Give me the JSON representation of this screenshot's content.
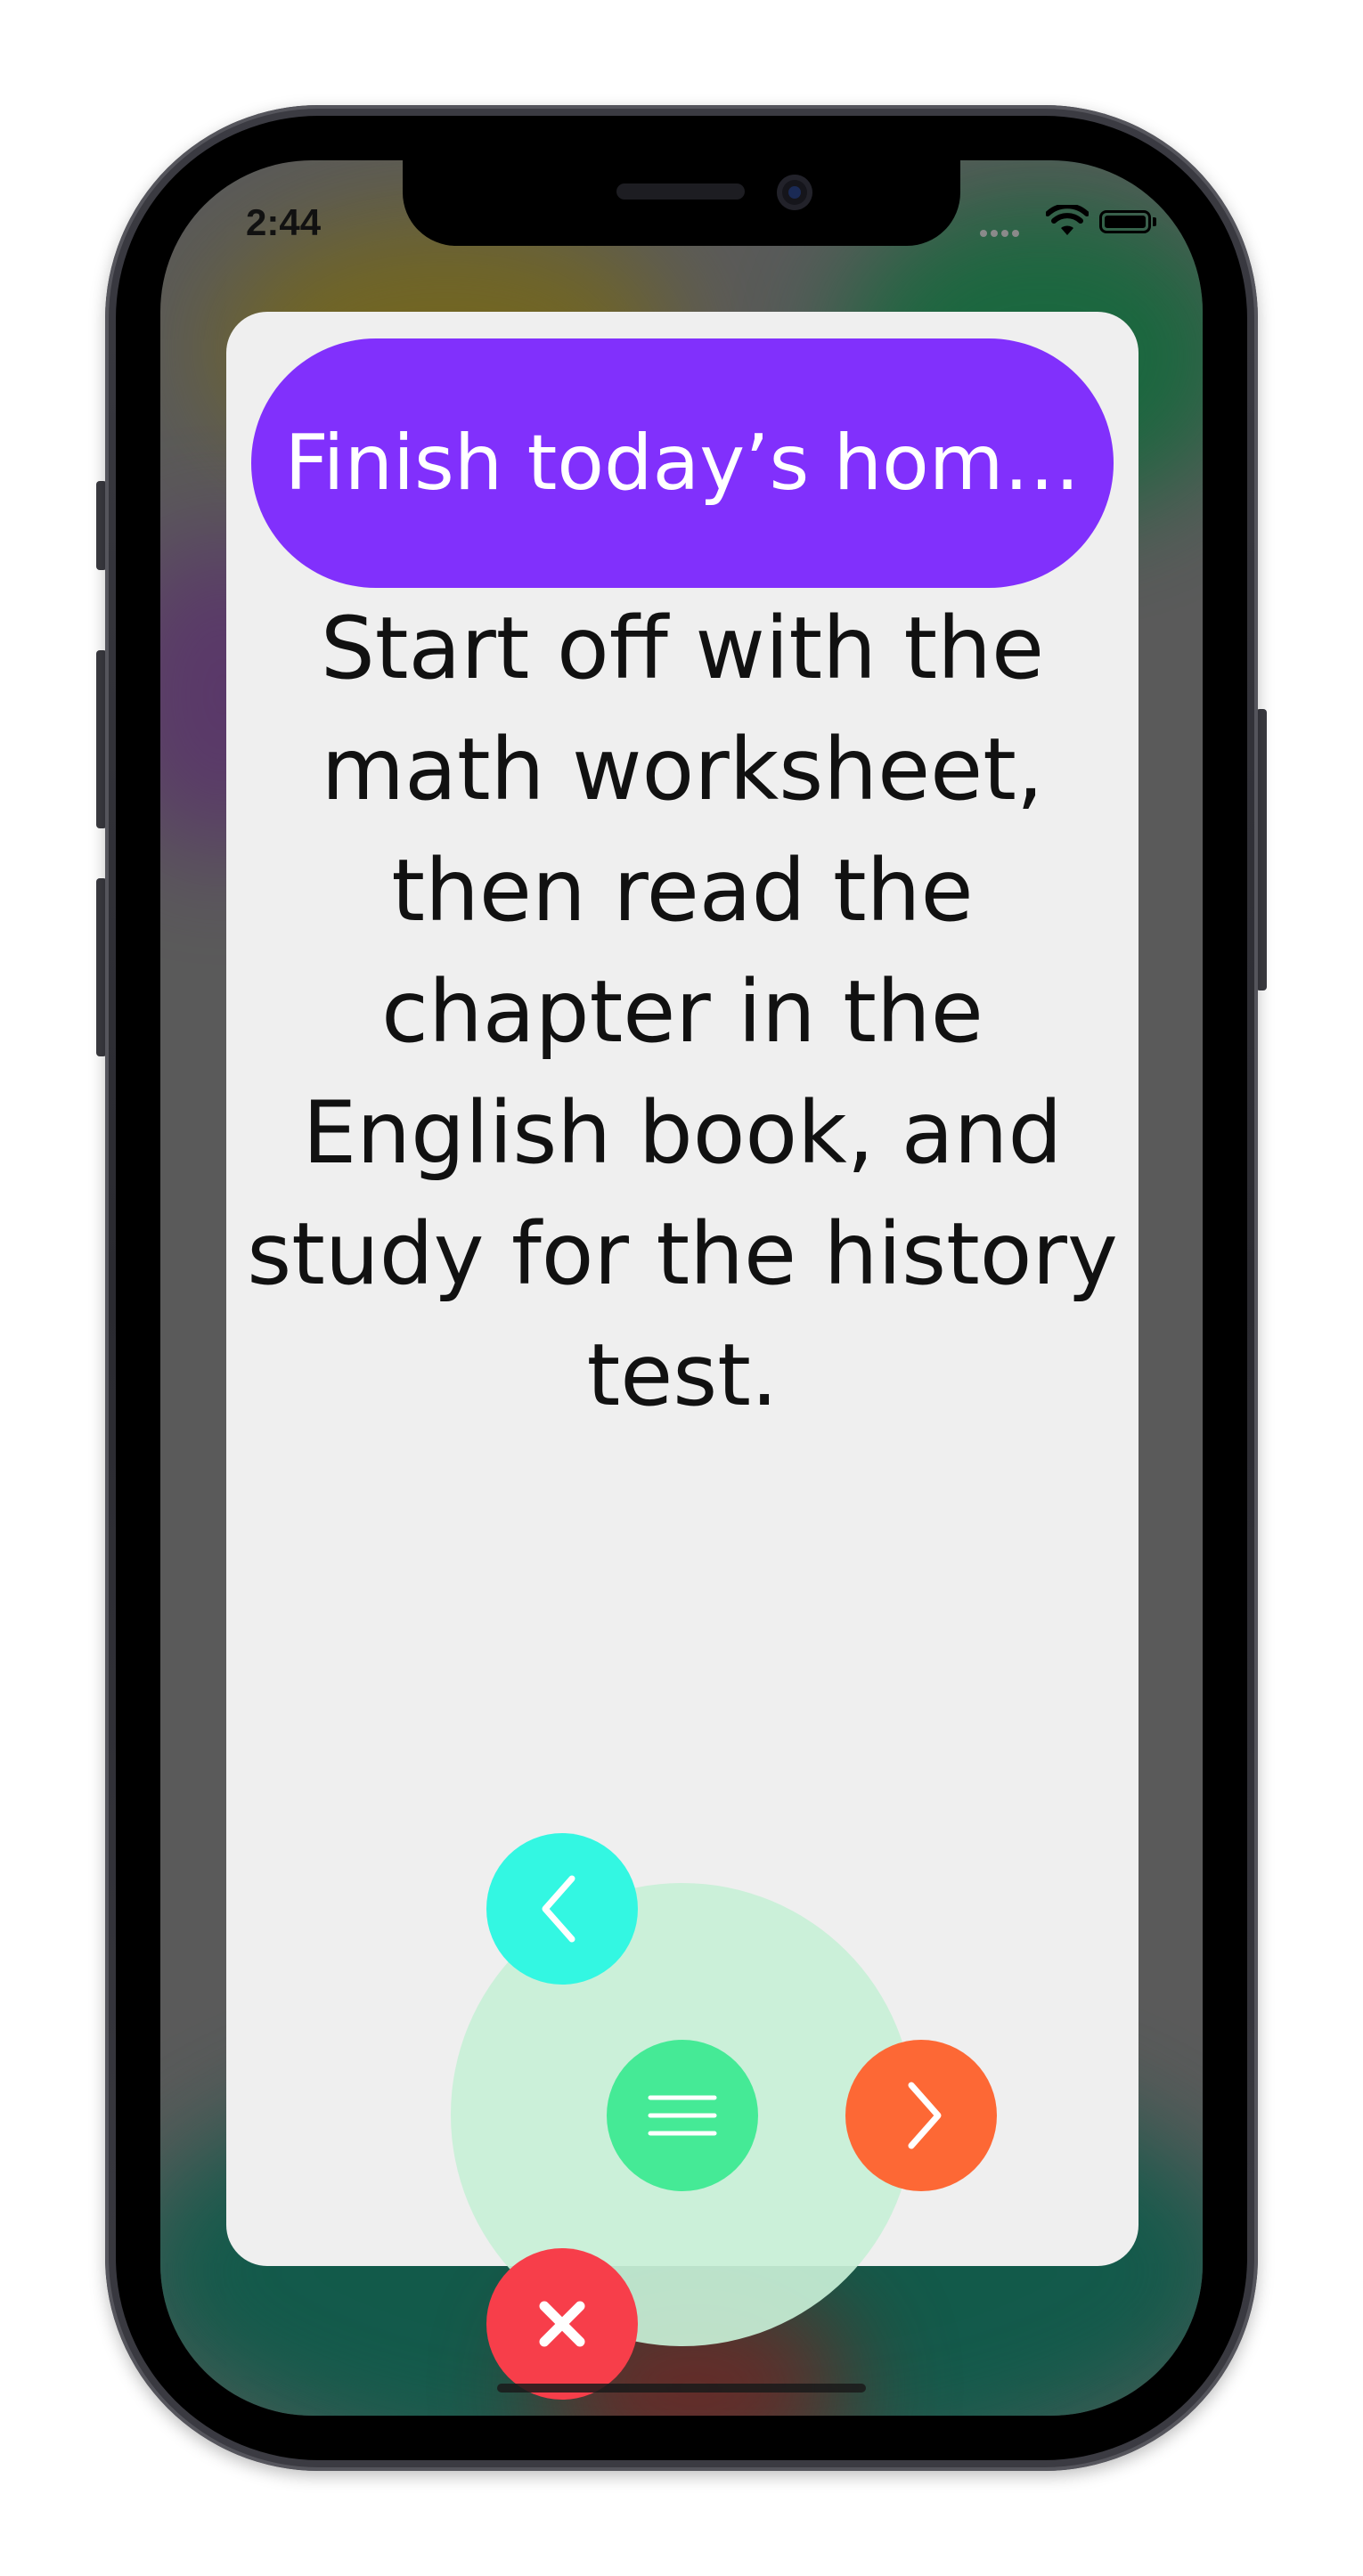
{
  "status_bar": {
    "time": "2:44",
    "icons": [
      "signal-icon",
      "wifi-icon",
      "battery-icon"
    ]
  },
  "card": {
    "title": "Finish today’s hom…",
    "description": "Start off with the math worksheet, then read the chapter in the English book, and study for the history test."
  },
  "fab_menu": {
    "buttons": [
      {
        "name": "back-button",
        "icon": "chevron-left-icon"
      },
      {
        "name": "menu-button",
        "icon": "hamburger-menu-icon"
      },
      {
        "name": "next-button",
        "icon": "chevron-right-icon"
      },
      {
        "name": "close-button",
        "icon": "close-icon"
      }
    ]
  },
  "colors": {
    "title_pill": "#8130fc",
    "card_background": "#efefef",
    "back_button": "#33f7e2",
    "menu_button": "#45ea96",
    "next_button": "#fd6835",
    "close_button": "#f73e4a",
    "menu_halo": "#c8f0d7"
  }
}
